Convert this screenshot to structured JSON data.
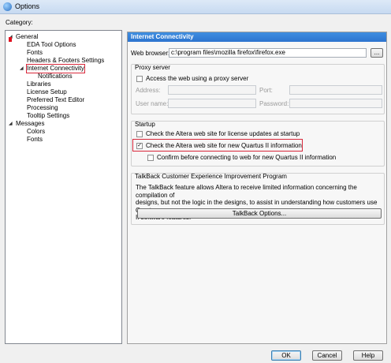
{
  "window": {
    "title": "Options"
  },
  "category_label": "Category:",
  "tree": [
    {
      "label": "General",
      "expander": "◢"
    },
    {
      "label": "EDA Tool Options"
    },
    {
      "label": "Fonts"
    },
    {
      "label": "Headers & Footers Settings"
    },
    {
      "label": "Internet Connectivity",
      "expander": "◢",
      "selected": true
    },
    {
      "label": "Notifications"
    },
    {
      "label": "Libraries"
    },
    {
      "label": "License Setup"
    },
    {
      "label": "Preferred Text Editor"
    },
    {
      "label": "Processing"
    },
    {
      "label": "Tooltip Settings"
    },
    {
      "label": "Messages",
      "expander": "◢"
    },
    {
      "label": "Colors"
    },
    {
      "label": "Fonts"
    }
  ],
  "panel": {
    "header": "Internet Connectivity",
    "web_browser": {
      "label": "Web browser:",
      "value": "c:\\program files\\mozilla firefox\\firefox.exe",
      "browse_label": "..."
    },
    "proxy": {
      "title": "Proxy server",
      "access_label": "Access the web using a proxy server",
      "access_checked": false,
      "address_label": "Address:",
      "port_label": "Port:",
      "user_label": "User name:",
      "password_label": "Password:"
    },
    "startup": {
      "title": "Startup",
      "license_label": "Check the Altera web site for license updates at startup",
      "license_checked": false,
      "quartus_label": "Check the Altera web site for new Quartus II information",
      "quartus_checked": true,
      "confirm_label": "Confirm before connecting to web for new Quartus II information",
      "confirm_checked": false
    },
    "talkback": {
      "title": "TalkBack Customer Experience Improvement Program",
      "description": "The TalkBack feature allows Altera to receive limited information concerning the compilation of\ndesigns, but not the logic in the designs, to assist in understanding how customers use Quartus\nII software features.",
      "button_label": "TalkBack Options..."
    }
  },
  "footer": {
    "ok_label": "OK",
    "cancel_label": "Cancel",
    "help_label": "Help"
  },
  "check_glyph": "✓"
}
